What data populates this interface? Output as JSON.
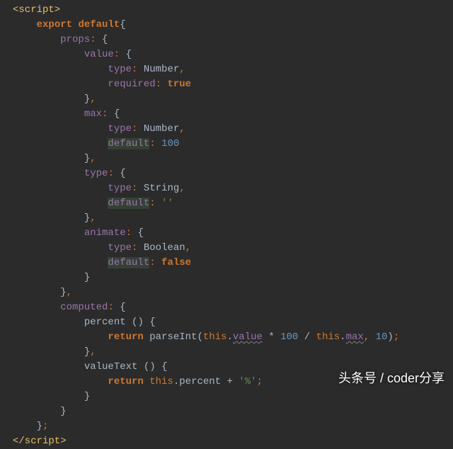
{
  "tags": {
    "open": "<script>",
    "close": "</script>"
  },
  "kw": {
    "export": "export",
    "default": "default",
    "return": "return",
    "true": "true",
    "false": "false",
    "this": "this"
  },
  "keys": {
    "props": "props",
    "value": "value",
    "type": "type",
    "required": "required",
    "max": "max",
    "default": "default",
    "animate": "animate",
    "computed": "computed",
    "percent": "percent",
    "valueText": "valueText"
  },
  "types": {
    "Number": "Number",
    "String": "String",
    "Boolean": "Boolean"
  },
  "nums": {
    "hundred": "100",
    "ten": "10"
  },
  "strs": {
    "empty": "''",
    "pct": "'%'"
  },
  "calls": {
    "parseInt": "parseInt"
  },
  "expr": {
    "valueHundred": "value * 100 /",
    "max": "max",
    "thisDot": ".",
    "percentProp": "percent"
  },
  "watermark": "头条号 / coder分享"
}
